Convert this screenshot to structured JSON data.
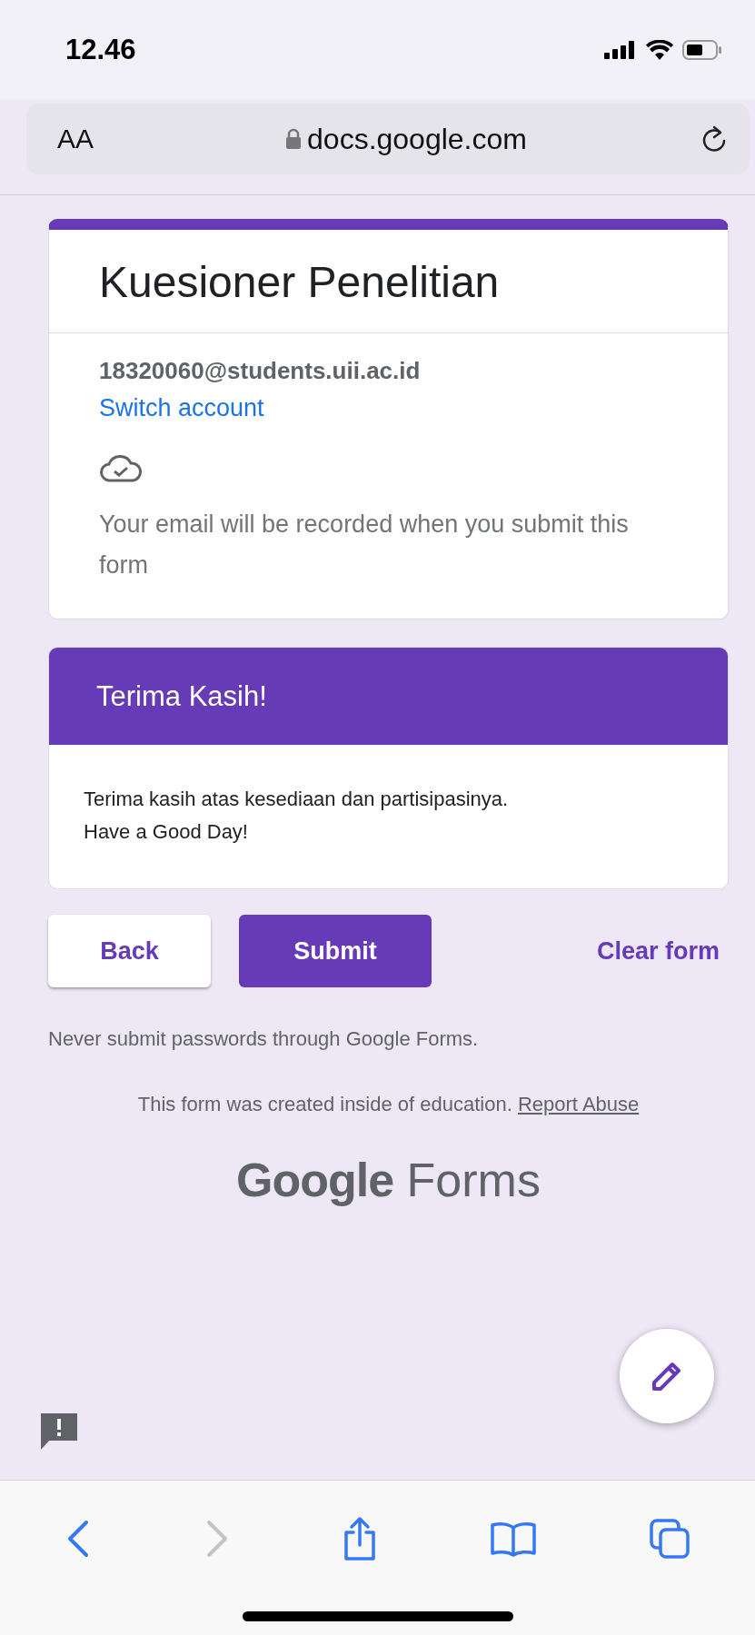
{
  "status_bar": {
    "time": "12.46"
  },
  "address_bar": {
    "text_size_label": "AA",
    "url": "docs.google.com"
  },
  "form": {
    "title": "Kuesioner Penelitian",
    "account_email": "18320060@students.uii.ac.id",
    "switch_account": "Switch account",
    "email_notice": "Your email will be recorded when you submit this form"
  },
  "section": {
    "title": "Terima Kasih!",
    "description": "Terima kasih atas kesediaan dan partisipasinya.\nHave a Good Day!"
  },
  "buttons": [
    {
      "kind": "outlined",
      "label": "Back"
    },
    {
      "kind": "filled",
      "label": "Submit"
    },
    {
      "kind": "text",
      "label": "Clear form"
    }
  ],
  "password_warning": "Never submit passwords through Google Forms.",
  "footer": {
    "created_note": "This form was created inside of education.",
    "report_link": "Report Abuse"
  },
  "brand": {
    "google": "Google",
    "forms": "Forms"
  }
}
